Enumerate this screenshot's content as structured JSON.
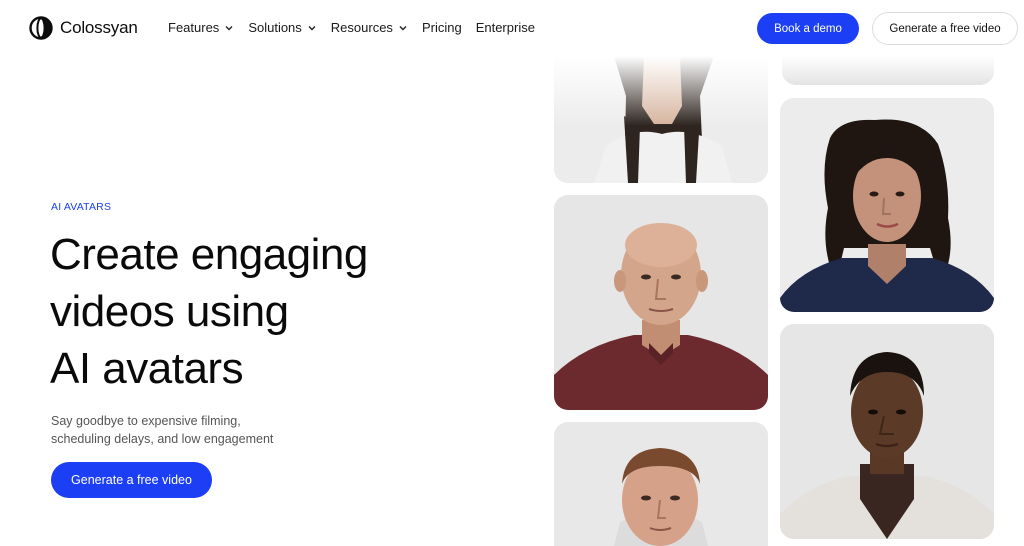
{
  "nav": {
    "logo_text": "Colossyan",
    "menu": [
      {
        "label": "Features",
        "has_dropdown": true
      },
      {
        "label": "Solutions",
        "has_dropdown": true
      },
      {
        "label": "Resources",
        "has_dropdown": true
      },
      {
        "label": "Pricing",
        "has_dropdown": false
      },
      {
        "label": "Enterprise",
        "has_dropdown": false
      }
    ],
    "book_demo_label": "Book a demo",
    "generate_label": "Generate a free video"
  },
  "hero": {
    "eyebrow": "AI AVATARS",
    "headline_line1": "Create engaging",
    "headline_line2": "videos using",
    "headline_line3": "AI avatars",
    "subtitle_line1": "Say goodbye to expensive filming,",
    "subtitle_line2": "scheduling delays, and low engagement",
    "cta_label": "Generate a free video"
  },
  "colors": {
    "accent": "#1c3ff5",
    "text": "#0a0a0a",
    "muted": "#555555",
    "card_bg": "#e9e9e9"
  },
  "avatars": [
    {
      "name": "avatar-woman-long-hair",
      "icon": "avatar-photo"
    },
    {
      "name": "avatar-bald-man",
      "icon": "avatar-photo"
    },
    {
      "name": "avatar-older-man",
      "icon": "avatar-photo"
    },
    {
      "name": "avatar-curly-hair-woman",
      "icon": "avatar-photo"
    },
    {
      "name": "avatar-young-man",
      "icon": "avatar-photo"
    }
  ]
}
